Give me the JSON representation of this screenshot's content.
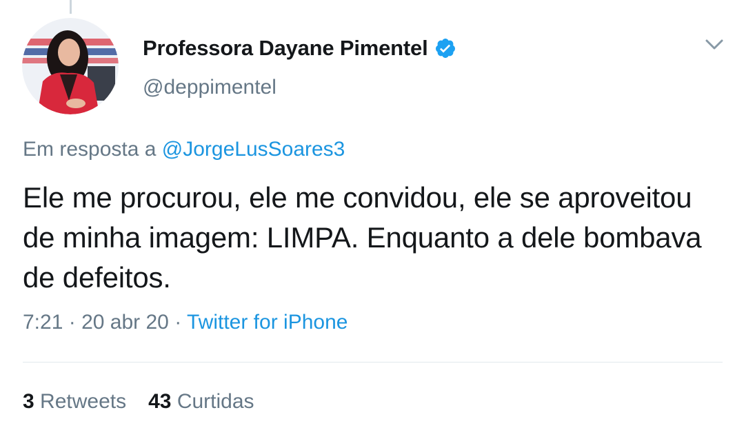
{
  "author": {
    "display_name": "Professora Dayane Pimentel",
    "handle": "@deppimentel",
    "verified": true
  },
  "reply": {
    "prefix": "Em resposta a",
    "mention": "@JorgeLusSoares3"
  },
  "tweet": {
    "text": "Ele me procurou, ele me convidou, ele se aproveitou de minha imagem: LIMPA. Enquanto a dele bombava de defeitos."
  },
  "meta": {
    "time": "7:21",
    "date": "20 abr 20",
    "separator": "·",
    "source": "Twitter for iPhone"
  },
  "stats": {
    "retweets_count": "3",
    "retweets_label": "Retweets",
    "likes_count": "43",
    "likes_label": "Curtidas"
  },
  "colors": {
    "link": "#1b95e0",
    "secondary_text": "#657786",
    "primary_text": "#14171a",
    "verified_badge": "#1da1f2",
    "avatar_jacket": "#d8283c"
  },
  "icons": {
    "verified": "verified-badge-icon",
    "menu": "chevron-down-icon"
  }
}
